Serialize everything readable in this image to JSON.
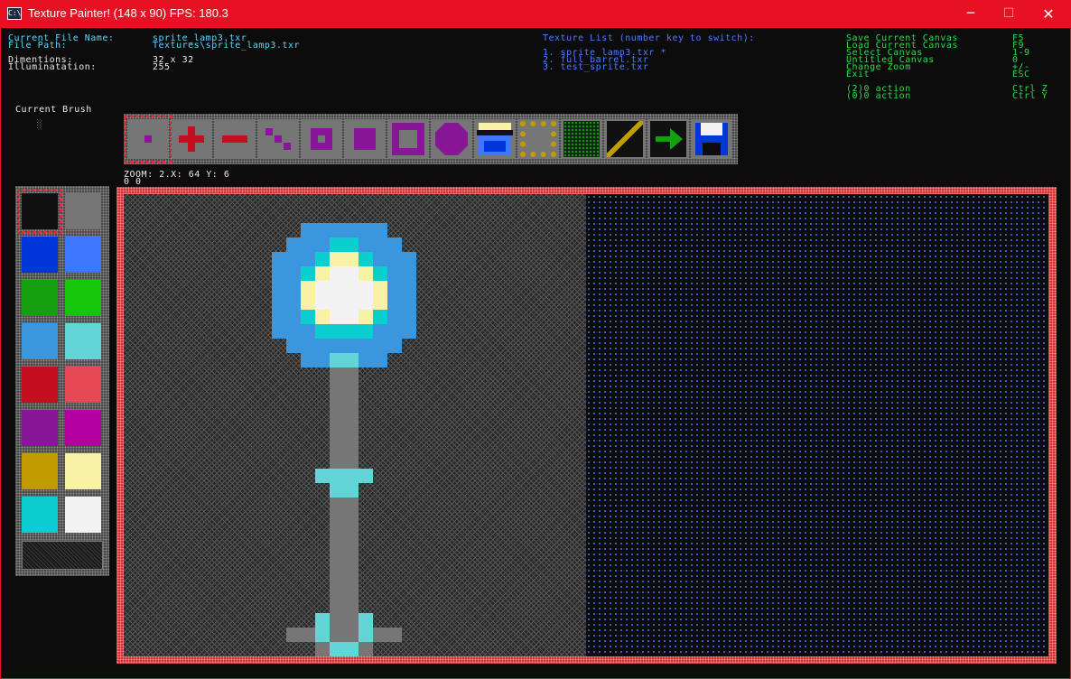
{
  "window": {
    "title": "Texture Painter! (148 x 90) FPS: 180.3",
    "minimize_glyph": "─",
    "maximize_glyph": "☐",
    "close_glyph": "✕",
    "app_icon_glyph": "C:\\"
  },
  "info": {
    "file_name_label": "Current File Name:",
    "file_name_value": "sprite_lamp3.txr",
    "file_path_label": "File Path:",
    "file_path_value": "Textures\\sprite_lamp3.txr",
    "dimensions_label": "Dimentions:",
    "dimensions_value": "32 x 32",
    "illumination_label": "Illuminatation:",
    "illumination_value": "255"
  },
  "texture_list": {
    "header": "Texture List (number key to switch):",
    "items": [
      "1. sprite_lamp3.txr *",
      "2. full_barrel.txr",
      "3. test_sprite.txr"
    ]
  },
  "shortcuts": [
    {
      "action": "Save Current Canvas",
      "key": "F5"
    },
    {
      "action": "Load Current Canvas",
      "key": "F9"
    },
    {
      "action": "Select Canvas",
      "key": "1-9"
    },
    {
      "action": "Untitled Canvas",
      "key": "0"
    },
    {
      "action": "Change Zoom",
      "key": "+/-"
    },
    {
      "action": "Exit",
      "key": "ESC"
    }
  ],
  "undo_redo": [
    {
      "action": "(2)0 action",
      "key": "Ctrl Z"
    },
    {
      "action": "(0)0 action",
      "key": "Ctrl Y"
    }
  ],
  "brush": {
    "label": "Current Brush",
    "preview_glyph": "░"
  },
  "status": {
    "zoom_line": "ZOOM: 2.X: 64  Y: 6",
    "second_line": "0 0"
  },
  "colors": {
    "titlebar": "#e81123",
    "selection": "#d13438",
    "palette": [
      "#111111",
      "#767676",
      "#0037da",
      "#3b78ff",
      "#13a10e",
      "#16c60c",
      "#3a96dd",
      "#61d6d6",
      "#c50f1f",
      "#e74856",
      "#881798",
      "#b4009e",
      "#c19c00",
      "#f9f1a5",
      "#0ccdd0",
      "#f2f2f2"
    ]
  },
  "tools": [
    {
      "name": "dot-brush"
    },
    {
      "name": "plus-brush"
    },
    {
      "name": "minus-brush"
    },
    {
      "name": "diagonal-brush"
    },
    {
      "name": "small-square-brush"
    },
    {
      "name": "filled-square-brush"
    },
    {
      "name": "hollow-square-brush"
    },
    {
      "name": "octagon-brush"
    },
    {
      "name": "sprite-face-brush"
    },
    {
      "name": "dotted-frame-brush"
    },
    {
      "name": "dark-green-texture"
    },
    {
      "name": "diagonal-line-texture"
    },
    {
      "name": "arrow-texture"
    },
    {
      "name": "floppy-save-icon"
    }
  ]
}
